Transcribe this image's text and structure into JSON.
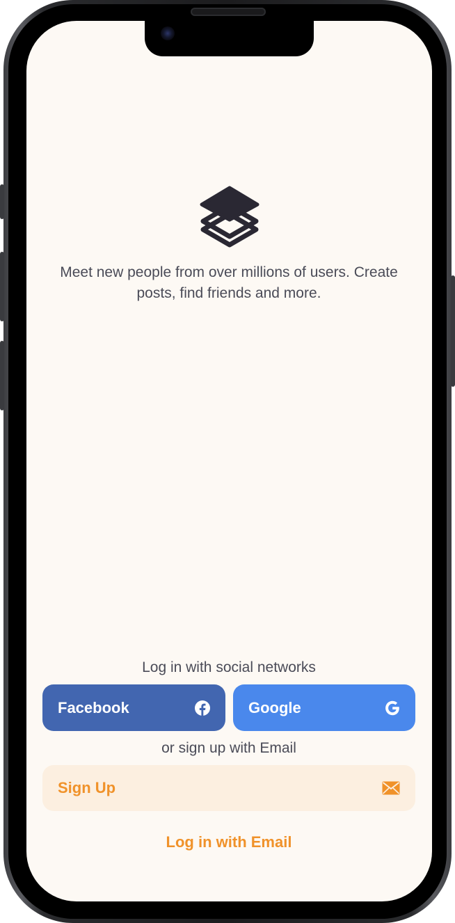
{
  "app": {
    "tagline": "Meet new people from over millions of users. Create posts, find friends and more."
  },
  "auth": {
    "social_label": "Log in with social networks",
    "facebook_label": "Facebook",
    "google_label": "Google",
    "email_divider": "or sign up with Email",
    "signup_label": "Sign Up",
    "login_email_label": "Log in with Email"
  },
  "icons": {
    "logo": "layers-icon",
    "facebook": "facebook-icon",
    "google": "google-icon",
    "mail": "mail-icon"
  },
  "colors": {
    "background": "#fdf9f4",
    "facebook": "#4266b0",
    "google": "#4a88ec",
    "accent": "#f0922a",
    "signup_bg": "#fcefe0",
    "text": "#4a4b57"
  }
}
